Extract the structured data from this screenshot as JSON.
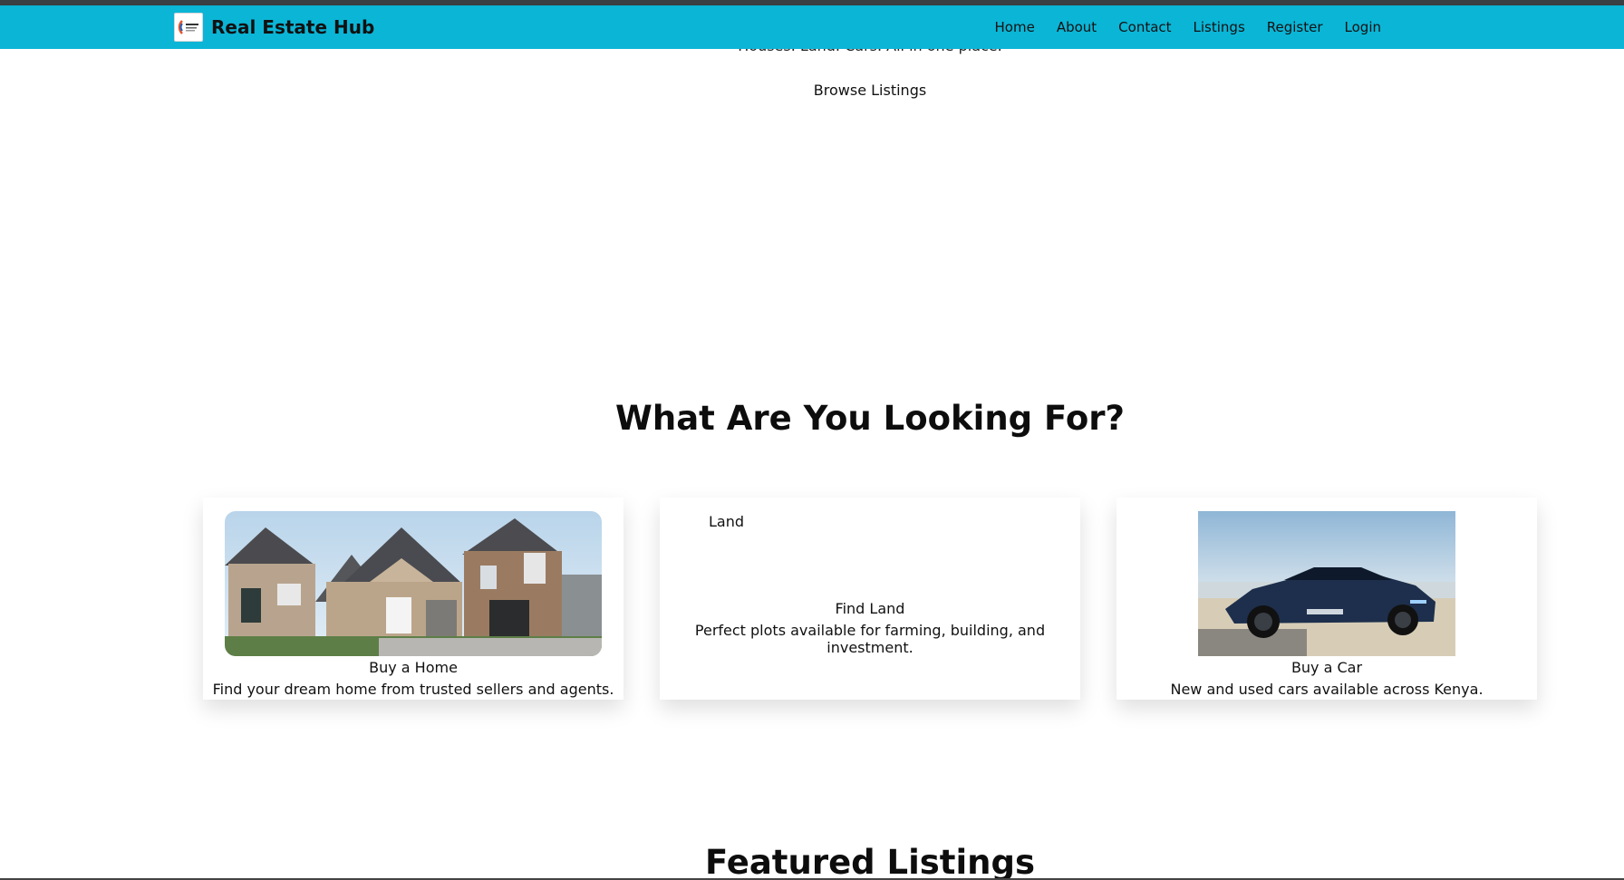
{
  "brand": {
    "name": "Real Estate Hub"
  },
  "nav": {
    "items": [
      {
        "label": "Home"
      },
      {
        "label": "About"
      },
      {
        "label": "Contact"
      },
      {
        "label": "Listings"
      },
      {
        "label": "Register"
      },
      {
        "label": "Login"
      }
    ]
  },
  "hero": {
    "tagline": "Houses. Land. Cars. All in one place.",
    "cta": "Browse Listings"
  },
  "categories": {
    "title": "What Are You Looking For?",
    "cards": [
      {
        "title": "Buy a Home",
        "description": "Find your dream home from trusted sellers and agents."
      },
      {
        "image_alt": "Land",
        "title": "Find Land",
        "description": "Perfect plots available for farming, building, and investment."
      },
      {
        "title": "Buy a Car",
        "description": "New and used cars available across Kenya."
      }
    ]
  },
  "featured": {
    "title": "Featured Listings"
  },
  "colors": {
    "navbar": "#0bb5d6",
    "topstrip": "#3a3f44"
  }
}
